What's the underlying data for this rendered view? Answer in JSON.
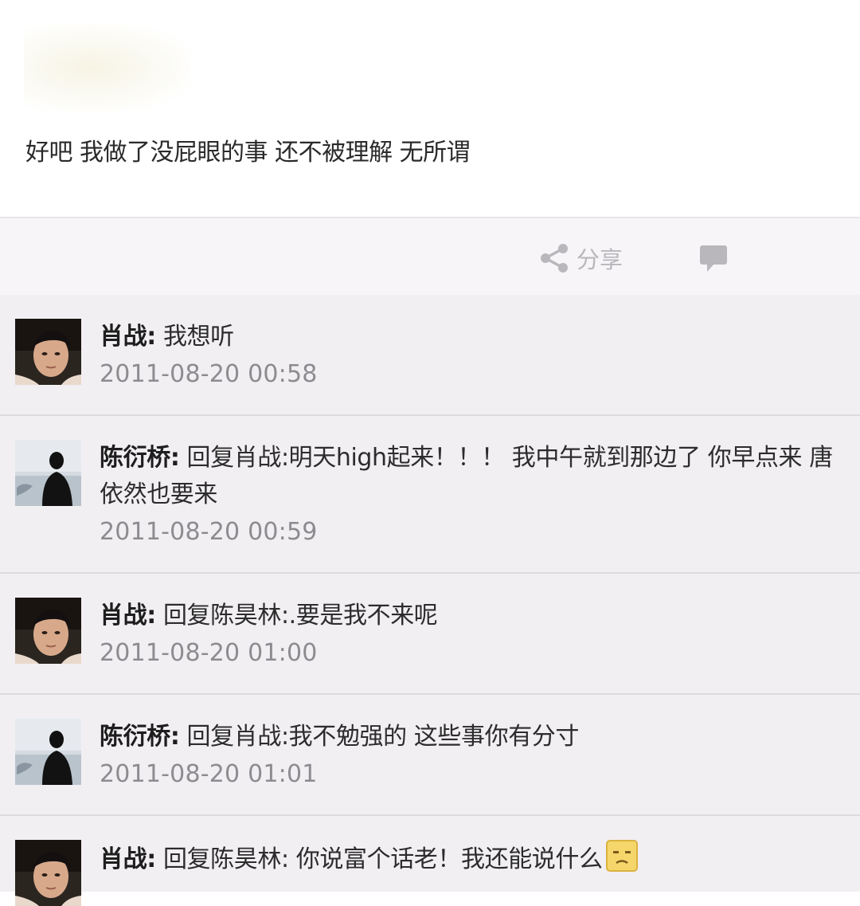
{
  "post": {
    "text": "好吧 我做了没屁眼的事 还不被理解 无所谓"
  },
  "actions": {
    "share_label": "分享",
    "share_icon": "share-icon",
    "comment_icon": "comment-icon"
  },
  "comments": [
    {
      "author": "肖战",
      "separator": ":",
      "text": " 我想听",
      "time": "2011-08-20 00:58",
      "avatar": "avatar-xiaozhan"
    },
    {
      "author": "陈衍桥",
      "separator": ":",
      "text": " 回复肖战:明天high起来！！！ 我中午就到那边了 你早点来 唐依然也要来",
      "time": "2011-08-20 00:59",
      "avatar": "avatar-chenyanqiao"
    },
    {
      "author": "肖战",
      "separator": ":",
      "text": " 回复陈昊林:.要是我不来呢",
      "time": "2011-08-20 01:00",
      "avatar": "avatar-xiaozhan"
    },
    {
      "author": "陈衍桥",
      "separator": ":",
      "text": " 回复肖战:我不勉强的 这些事你有分寸",
      "time": "2011-08-20 01:01",
      "avatar": "avatar-chenyanqiao"
    },
    {
      "author": "肖战",
      "separator": ":",
      "text": " 回复陈昊林: 你说富个话老！我还能说什么",
      "emoji": "embarrassed-emoji",
      "time": "",
      "avatar": "avatar-xiaozhan"
    }
  ],
  "colors": {
    "bar_bg": "#f7f5f8",
    "comments_bg": "#f2eff3",
    "timestamp": "#8e8b90",
    "icon_gray": "#b9b7bb"
  }
}
